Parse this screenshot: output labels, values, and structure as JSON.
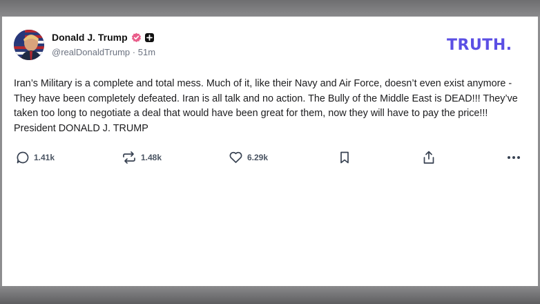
{
  "post": {
    "display_name": "Donald J. Trump",
    "handle": "@realDonaldTrump",
    "separator": "·",
    "time_ago": "51m",
    "body": "Iran’s Military is a complete and total mess. Much of it, like their Navy and Air Force, doesn’t even exist anymore - They have been completely defeated. Iran is all talk and no action. The Bully of the Middle East is DEAD!!! They’ve taken too long to negotiate a deal that would have been great for them, now they will have to pay the price!!! President DONALD J. TRUMP"
  },
  "brand": {
    "logo_text": "TRUTH.",
    "color": "#5b4fe4"
  },
  "badges": {
    "verified_color": "#e95d8a",
    "plus_icon": "plus-icon"
  },
  "actions": {
    "replies": {
      "icon": "reply-icon",
      "count": "1.41k"
    },
    "retruths": {
      "icon": "retruth-icon",
      "count": "1.48k"
    },
    "likes": {
      "icon": "heart-icon",
      "count": "6.29k"
    },
    "bookmark": {
      "icon": "bookmark-icon"
    },
    "share": {
      "icon": "share-icon"
    },
    "more": {
      "icon": "more-icon"
    }
  }
}
